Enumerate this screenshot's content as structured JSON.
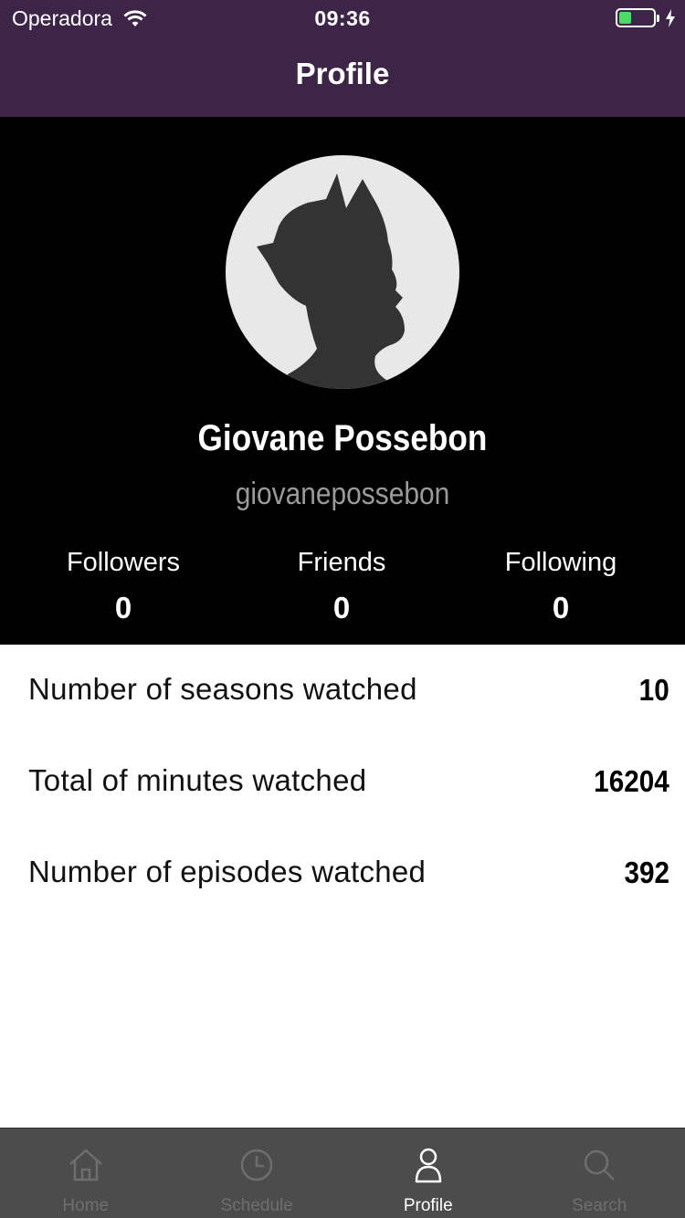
{
  "status_bar": {
    "carrier": "Operadora",
    "time": "09:36",
    "wifi_icon": "wifi-icon",
    "battery_icon": "battery-charging-icon"
  },
  "nav": {
    "title": "Profile"
  },
  "profile": {
    "avatar_icon": "person-silhouette-icon",
    "name": "Giovane Possebon",
    "username": "giovanepossebon",
    "counters": [
      {
        "label": "Followers",
        "value": "0"
      },
      {
        "label": "Friends",
        "value": "0"
      },
      {
        "label": "Following",
        "value": "0"
      }
    ]
  },
  "stats": [
    {
      "label": "Number of seasons watched",
      "value": "10"
    },
    {
      "label": "Total of minutes watched",
      "value": "16204"
    },
    {
      "label": "Number of episodes watched",
      "value": "392"
    }
  ],
  "tabbar": {
    "tabs": [
      {
        "label": "Home",
        "icon": "home-icon",
        "active": false
      },
      {
        "label": "Schedule",
        "icon": "clock-icon",
        "active": false
      },
      {
        "label": "Profile",
        "icon": "user-icon",
        "active": true
      },
      {
        "label": "Search",
        "icon": "search-icon",
        "active": false
      }
    ]
  },
  "colors": {
    "nav_background": "#3d2547",
    "header_background": "#000000",
    "tabbar_background": "#4c4c4c",
    "battery_fill": "#4cd964"
  }
}
